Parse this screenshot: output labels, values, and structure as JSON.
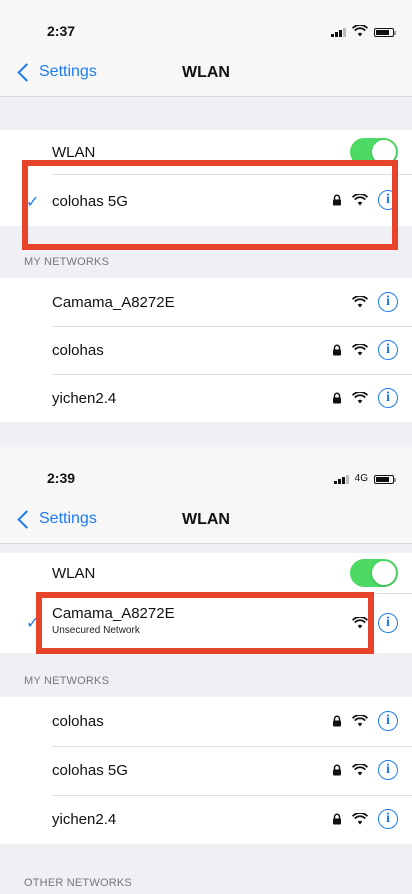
{
  "screens": [
    {
      "time": "2:37",
      "network_type": "",
      "back_label": "Settings",
      "title": "WLAN",
      "wlan_label": "WLAN",
      "wlan_on": true,
      "connected": {
        "name": "colohas 5G",
        "sublabel": ""
      },
      "my_networks_header": "MY NETWORKS",
      "networks": [
        "Camama_A8272E",
        "colohas",
        "yichen2.4"
      ]
    },
    {
      "time": "2:39",
      "network_type": "4G",
      "back_label": "Settings",
      "title": "WLAN",
      "wlan_label": "WLAN",
      "wlan_on": true,
      "connected": {
        "name": "Camama_A8272E",
        "sublabel": "Unsecured Network"
      },
      "my_networks_header": "MY NETWORKS",
      "networks": [
        "colohas",
        "colohas 5G",
        "yichen2.4"
      ],
      "other_networks_header": "OTHER NETWORKS"
    }
  ],
  "icons": {
    "back": "chevron-left-icon",
    "lock": "lock-icon",
    "wifi": "wifi-icon",
    "info": "info-icon",
    "check": "checkmark-icon"
  },
  "colors": {
    "accent": "#1e7bf0",
    "toggle_on": "#4cd964",
    "highlight": "#e8432b"
  },
  "info_glyph": "i",
  "check_glyph": "✓"
}
